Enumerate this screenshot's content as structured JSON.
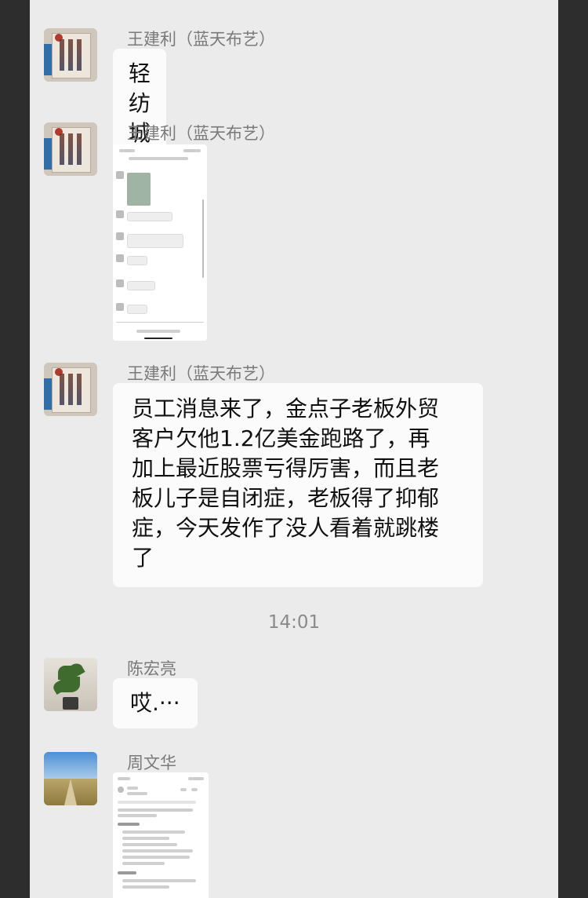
{
  "chat": {
    "messages": [
      {
        "sender": "王建利（蓝天布艺）",
        "avatar": "store-sign-avatar",
        "text": "轻纺城重大消息"
      },
      {
        "sender": "王建利（蓝天布艺）",
        "avatar": "store-sign-avatar",
        "image": "chat-screenshot-image"
      },
      {
        "sender": "王建利（蓝天布艺）",
        "avatar": "store-sign-avatar",
        "lines": [
          "员工消息来了，金点子老板外贸",
          "客户欠他1.2亿美金跑路了，再",
          "加上最近股票亏得厉害，而且老",
          "板儿子是自闭症，老板得了抑郁",
          "症，今天发作了没人看着就跳楼",
          "了"
        ]
      },
      {
        "sender": "陈宏亮",
        "avatar": "plant-avatar",
        "text": "哎.···"
      },
      {
        "sender": "周文华",
        "avatar": "landscape-avatar",
        "image": "company-info-screenshot-image"
      }
    ],
    "timestamp": "14:01"
  }
}
